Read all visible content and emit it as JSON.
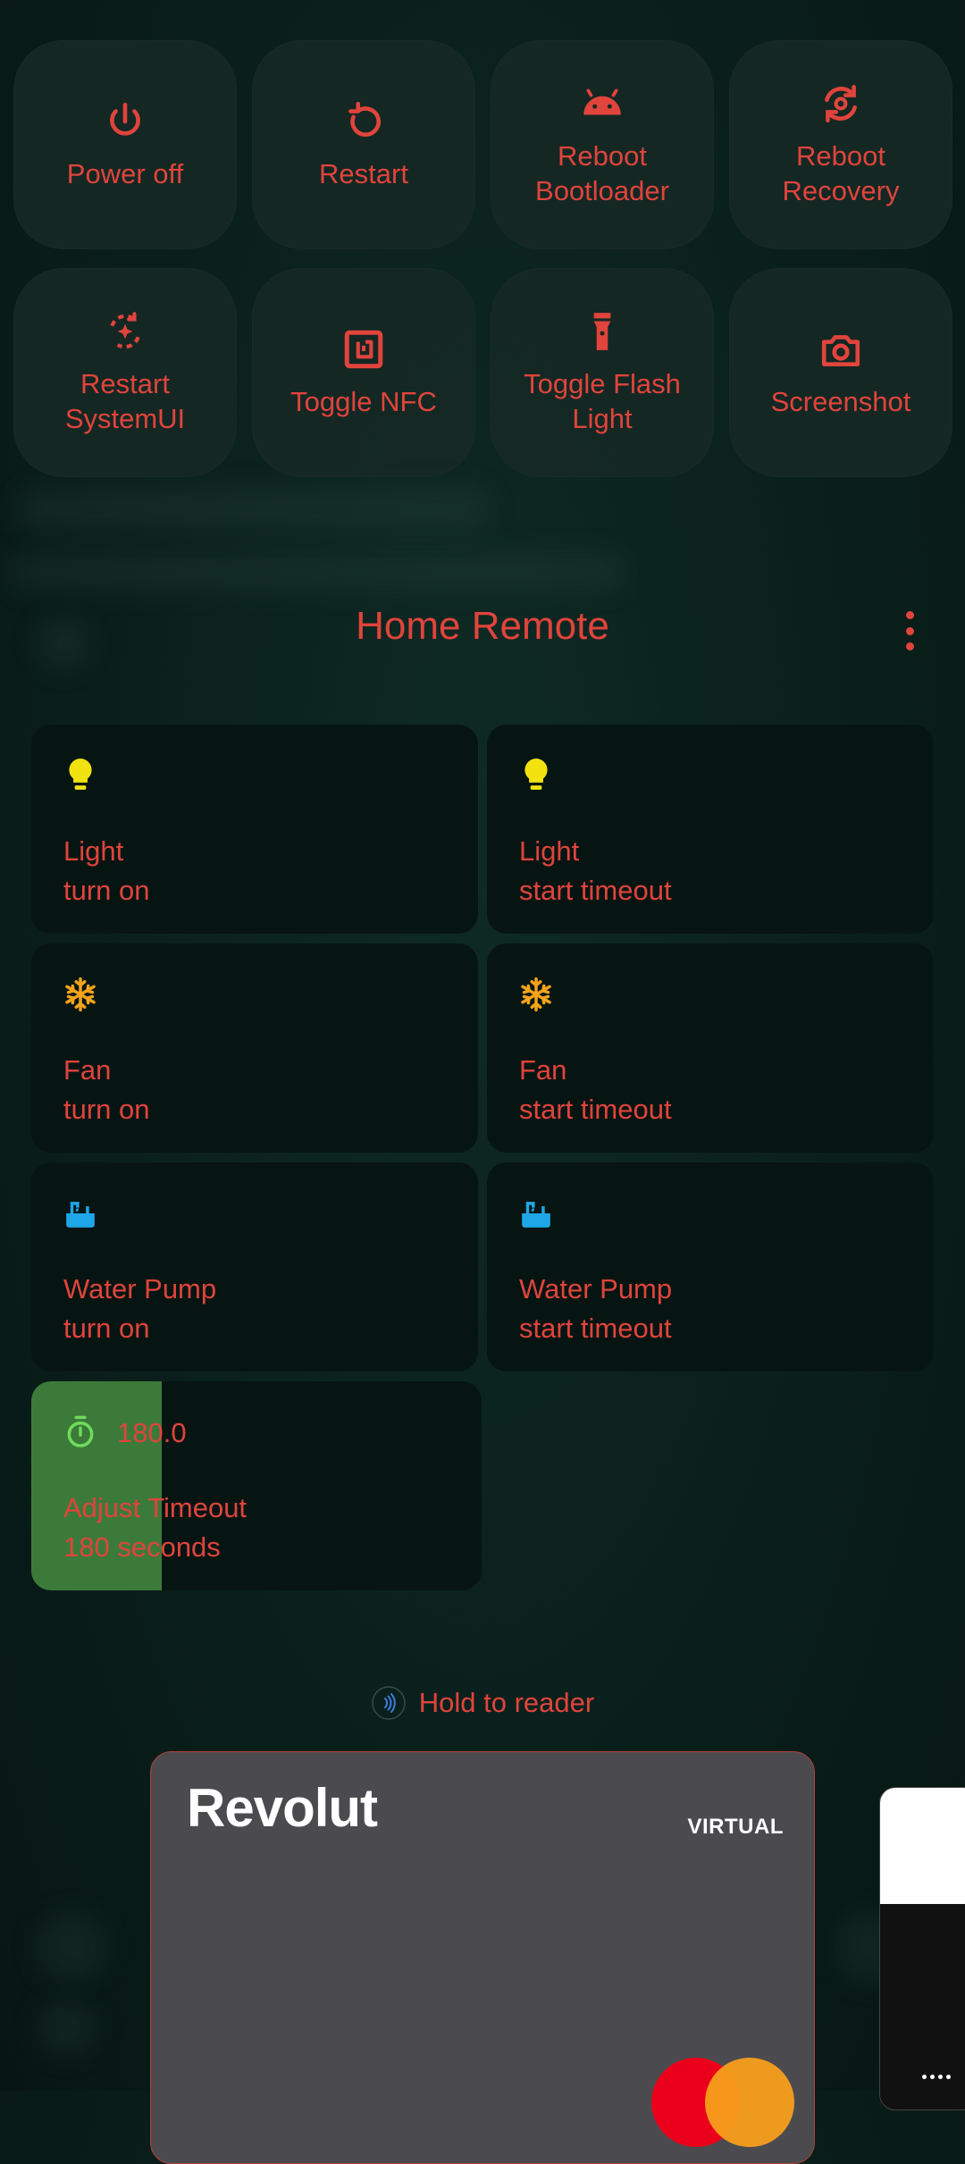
{
  "power_menu": {
    "items": [
      {
        "label": "Power off",
        "icon": "power-icon"
      },
      {
        "label": "Restart",
        "icon": "restart-icon"
      },
      {
        "label": "Reboot\nBootloader",
        "icon": "android-icon"
      },
      {
        "label": "Reboot\nRecovery",
        "icon": "recovery-icon"
      },
      {
        "label": "Restart\nSystemUI",
        "icon": "systemui-restart-icon"
      },
      {
        "label": "Toggle NFC",
        "icon": "nfc-icon"
      },
      {
        "label": "Toggle Flash\nLight",
        "icon": "flashlight-icon"
      },
      {
        "label": "Screenshot",
        "icon": "camera-icon"
      }
    ]
  },
  "home_remote": {
    "title": "Home Remote",
    "controls": [
      {
        "title": "Light",
        "subtitle": "turn on",
        "icon": "lightbulb-icon",
        "color": "#f2e20f"
      },
      {
        "title": "Light",
        "subtitle": "start timeout",
        "icon": "lightbulb-icon",
        "color": "#f2e20f"
      },
      {
        "title": "Fan",
        "subtitle": "turn on",
        "icon": "snowflake-icon",
        "color": "#f5a31a"
      },
      {
        "title": "Fan",
        "subtitle": "start timeout",
        "icon": "snowflake-icon",
        "color": "#f5a31a"
      },
      {
        "title": "Water Pump",
        "subtitle": "turn on",
        "icon": "water-pump-icon",
        "color": "#1ea7e8"
      },
      {
        "title": "Water Pump",
        "subtitle": "start timeout",
        "icon": "water-pump-icon",
        "color": "#1ea7e8"
      }
    ],
    "timeout": {
      "value": "180.0",
      "title": "Adjust Timeout",
      "subtitle": "180 seconds",
      "icon": "timer-icon",
      "icon_color": "#6fdc5b",
      "level_fraction": 0.29
    }
  },
  "wallet": {
    "hint": "Hold to reader",
    "card": {
      "brand": "Revolut",
      "tag": "VIRTUAL"
    }
  },
  "colors": {
    "accent": "#e0443c",
    "timeout_fill": "#3c7a3a",
    "tile_bg": "#071512"
  }
}
